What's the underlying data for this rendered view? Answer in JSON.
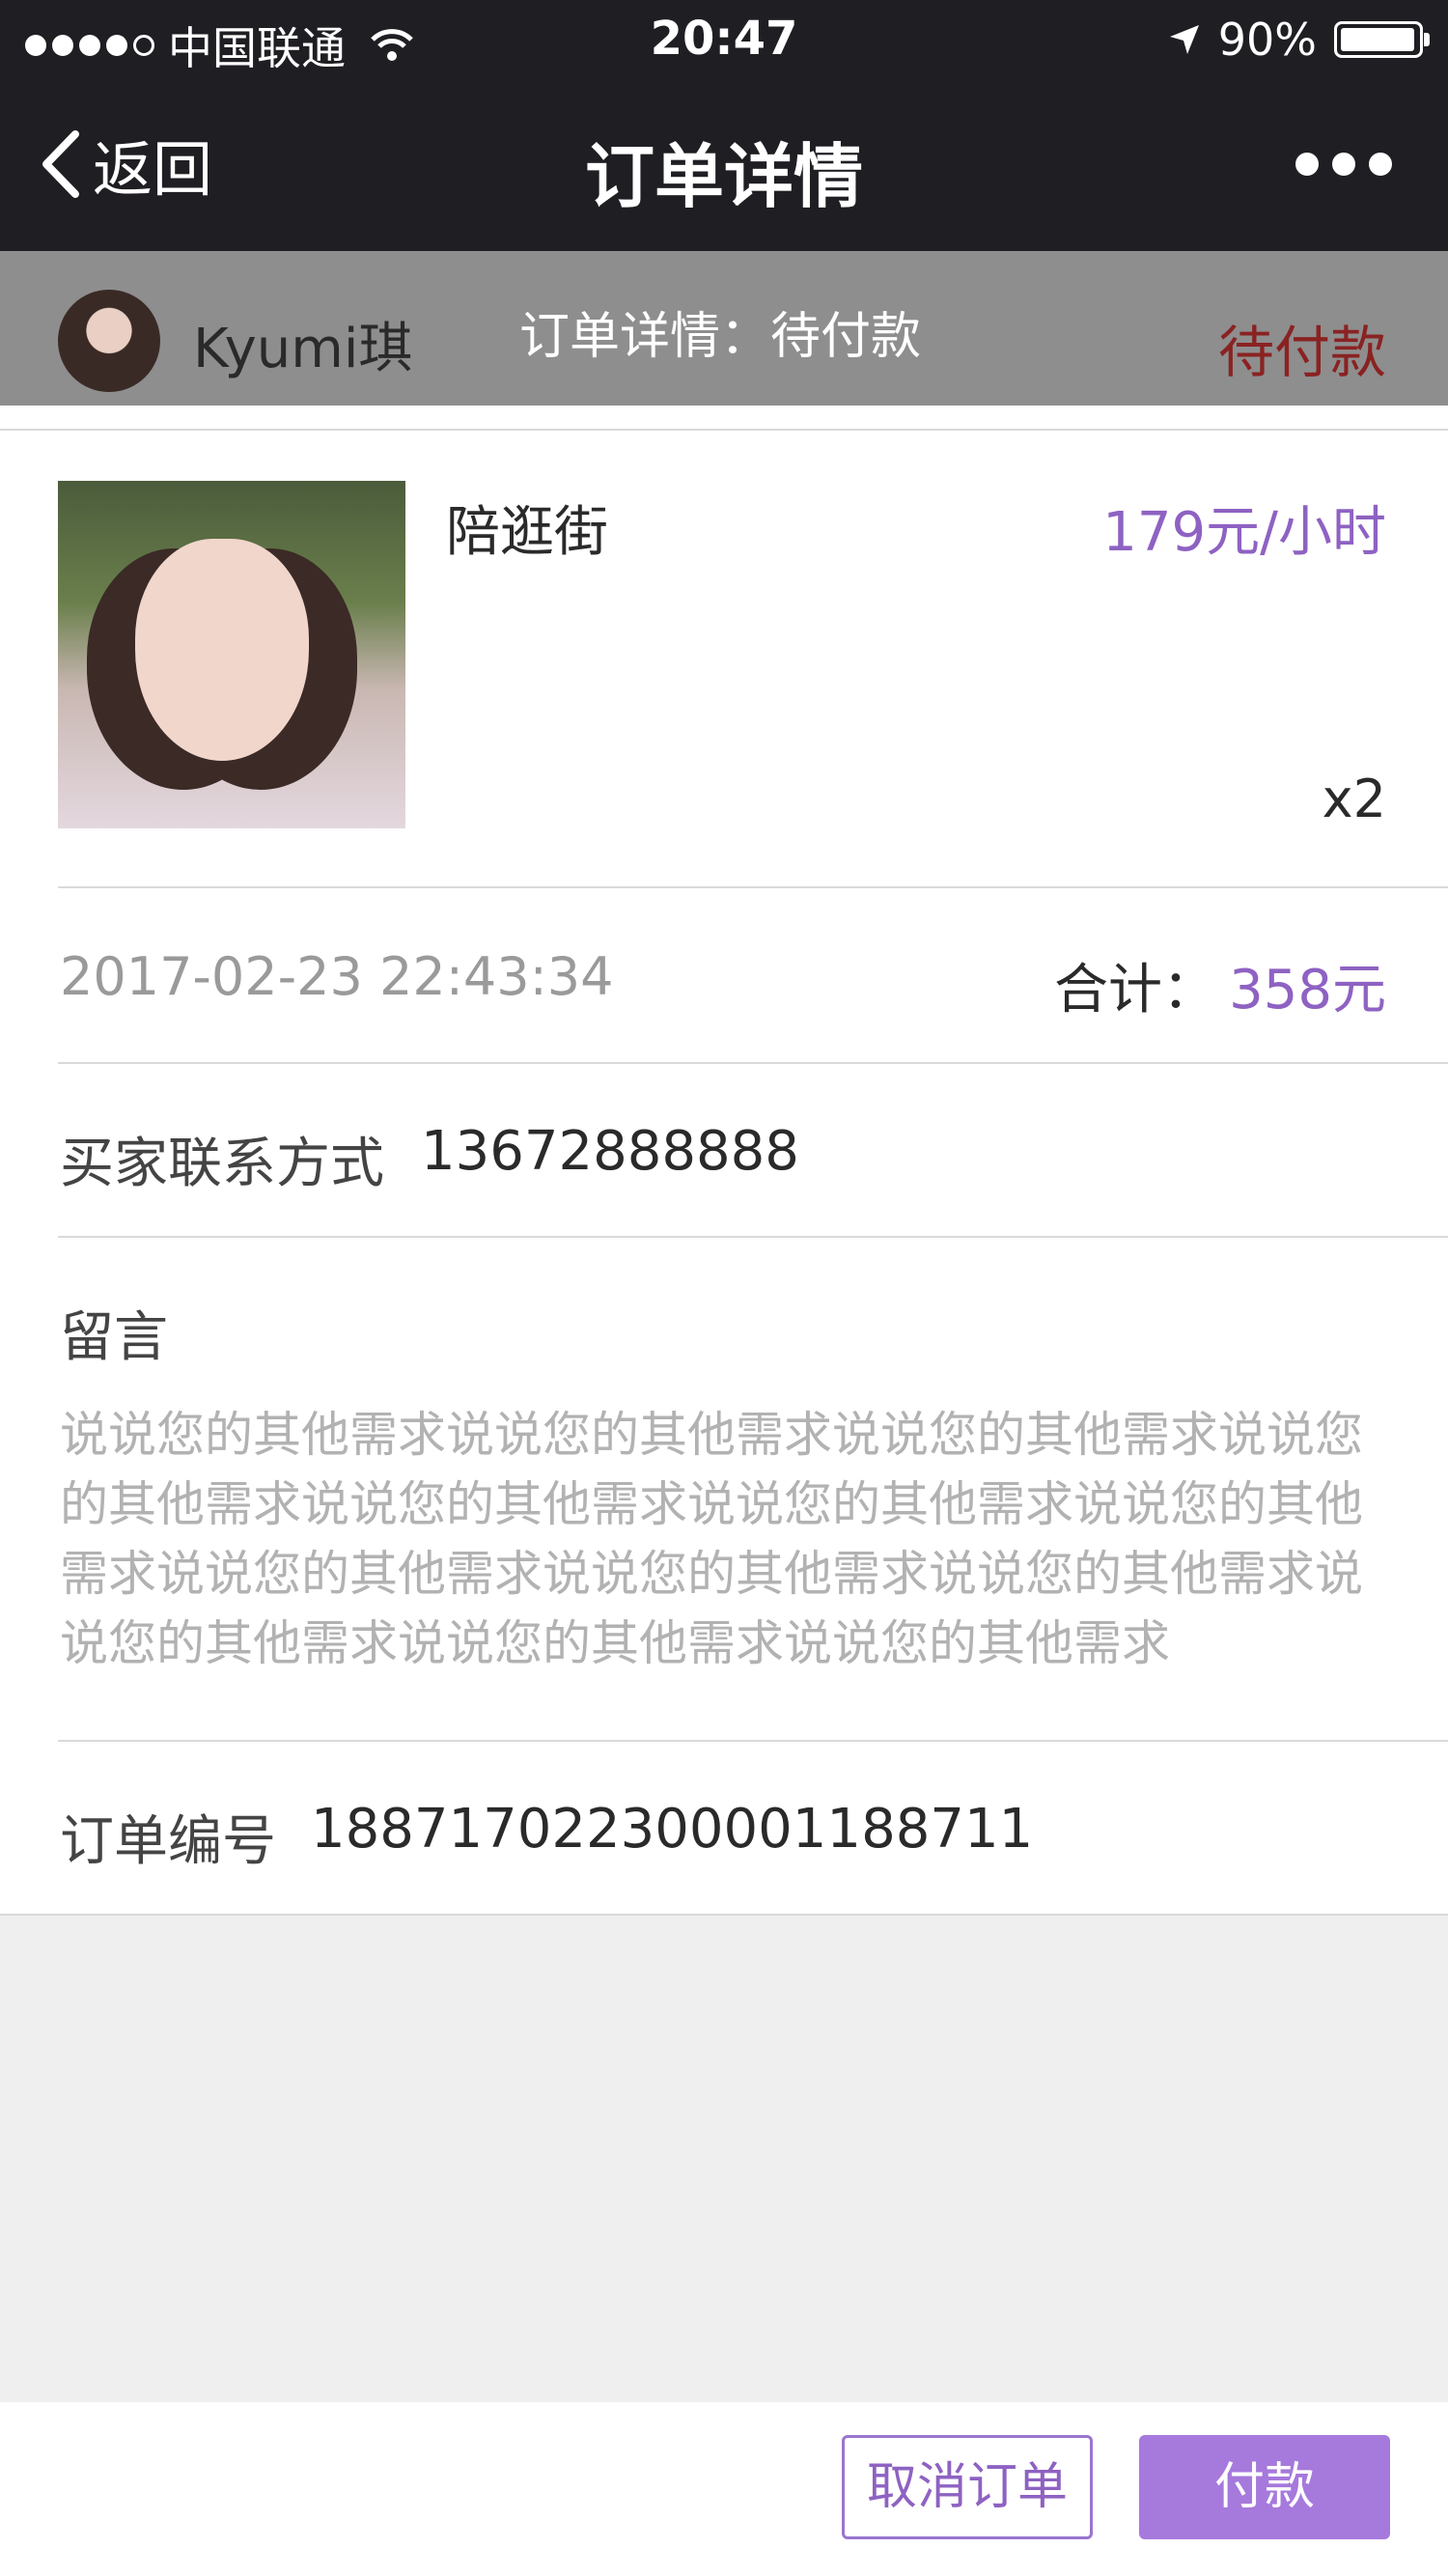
{
  "status_bar": {
    "carrier": "中国联通",
    "time": "20:47",
    "battery": "90%"
  },
  "nav": {
    "back_label": "返回",
    "title": "订单详情"
  },
  "order_header": {
    "username": "Kyumi琪",
    "center_text": "订单详情：待付款",
    "status": "待付款"
  },
  "product": {
    "name": "陪逛街",
    "price": "179元/小时",
    "quantity": "x2"
  },
  "summary": {
    "date": "2017-02-23 22:43:34",
    "total_label": "合计：",
    "total_value": "358元"
  },
  "contact": {
    "label": "买家联系方式",
    "value": "13672888888"
  },
  "message": {
    "label": "留言",
    "text": "说说您的其他需求说说您的其他需求说说您的其他需求说说您的其他需求说说您的其他需求说说您的其他需求说说您的其他需求说说您的其他需求说说您的其他需求说说您的其他需求说说您的其他需求说说您的其他需求说说您的其他需求"
  },
  "order_no": {
    "label": "订单编号",
    "value": "188717022300001188711"
  },
  "buttons": {
    "cancel": "取消订单",
    "pay": "付款"
  },
  "colors": {
    "accent": "#8e62c2",
    "pay_button": "#a679dc",
    "status_red": "#8a2222"
  }
}
